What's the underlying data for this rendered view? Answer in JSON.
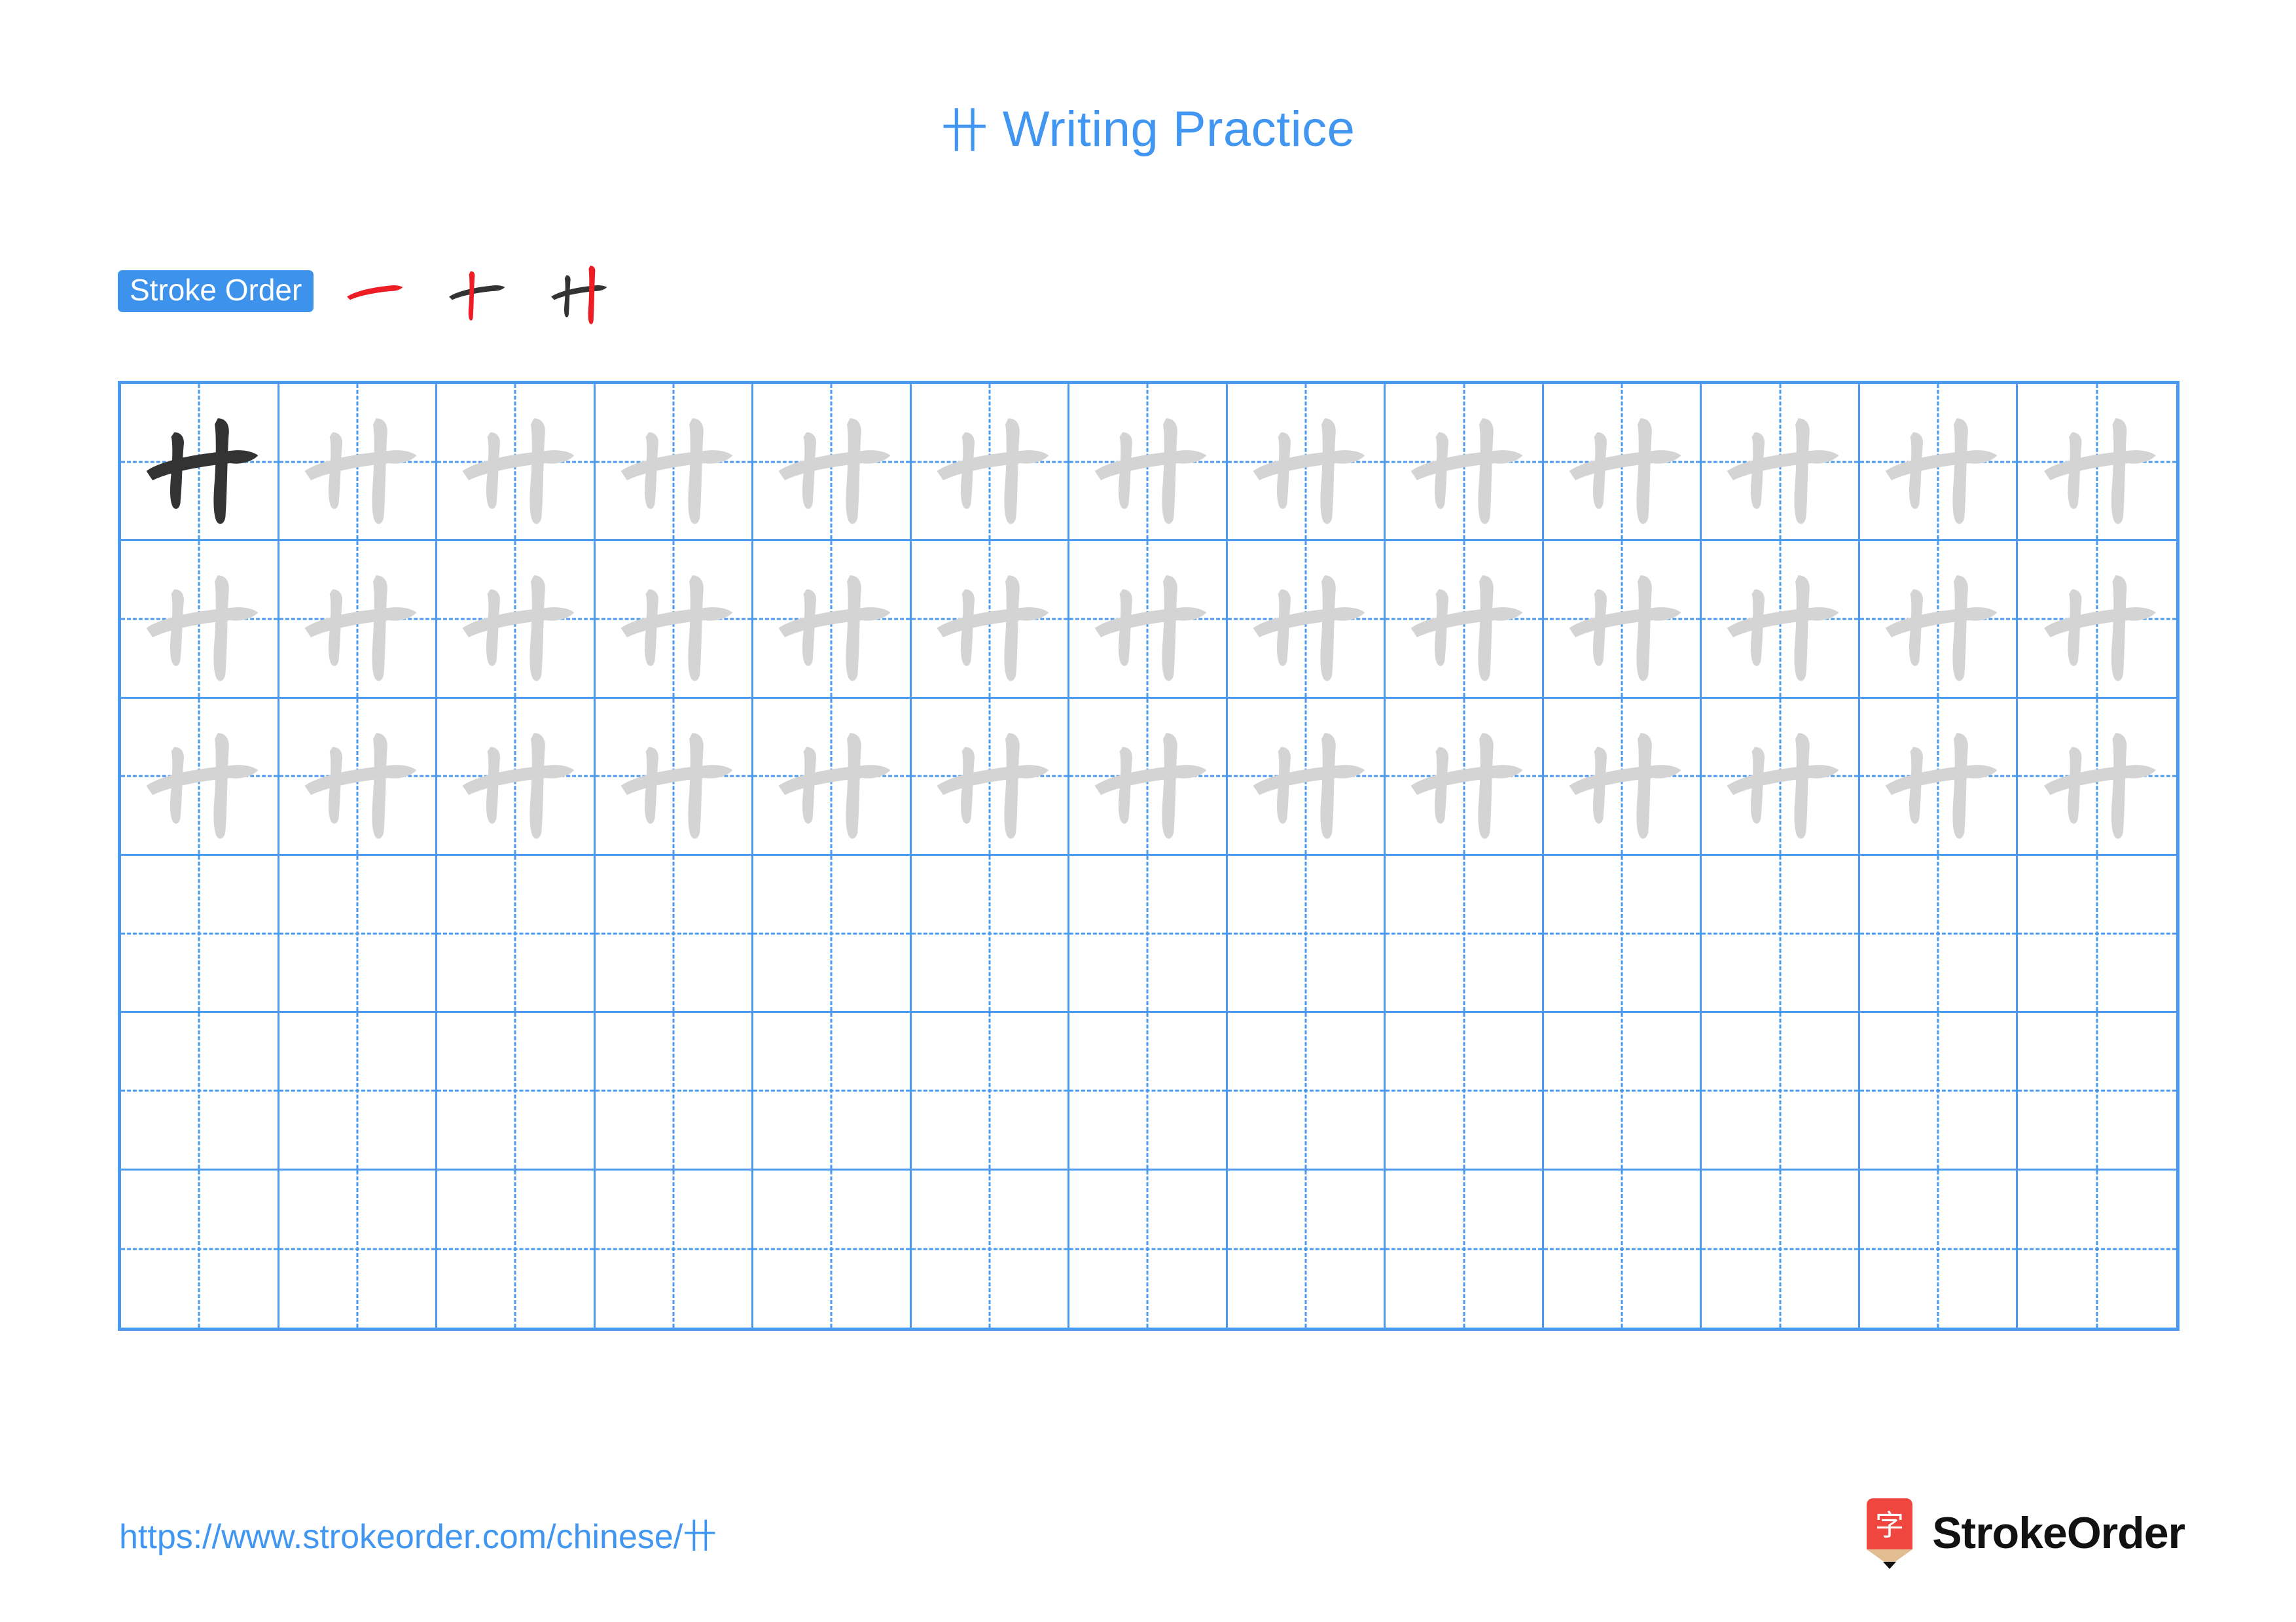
{
  "page": {
    "character": "卄",
    "title_suffix": " Writing Practice",
    "background_color": "#ffffff",
    "accent_color": "#4096f0",
    "grid_line_color": "#4a9bf0",
    "traced_stroke_color": "#d4d4d4",
    "solid_stroke_color": "#333333",
    "new_stroke_color": "#ee1c25"
  },
  "stroke_order": {
    "label": "Stroke Order",
    "badge_bg": "#3d93ec",
    "badge_text_color": "#ffffff",
    "total_strokes": 3,
    "steps": [
      {
        "index": 1,
        "strokes_shown": [
          "heng"
        ],
        "new_stroke": "heng"
      },
      {
        "index": 2,
        "strokes_shown": [
          "heng",
          "shu-left"
        ],
        "new_stroke": "shu-left"
      },
      {
        "index": 3,
        "strokes_shown": [
          "heng",
          "shu-left",
          "shu-right"
        ],
        "new_stroke": "shu-right"
      }
    ]
  },
  "grid": {
    "columns": 13,
    "rows": 6,
    "rows_data": [
      {
        "row": 1,
        "cells": [
          "solid",
          "trace",
          "trace",
          "trace",
          "trace",
          "trace",
          "trace",
          "trace",
          "trace",
          "trace",
          "trace",
          "trace",
          "trace"
        ]
      },
      {
        "row": 2,
        "cells": [
          "trace",
          "trace",
          "trace",
          "trace",
          "trace",
          "trace",
          "trace",
          "trace",
          "trace",
          "trace",
          "trace",
          "trace",
          "trace"
        ]
      },
      {
        "row": 3,
        "cells": [
          "trace",
          "trace",
          "trace",
          "trace",
          "trace",
          "trace",
          "trace",
          "trace",
          "trace",
          "trace",
          "trace",
          "trace",
          "trace"
        ]
      },
      {
        "row": 4,
        "cells": [
          "empty",
          "empty",
          "empty",
          "empty",
          "empty",
          "empty",
          "empty",
          "empty",
          "empty",
          "empty",
          "empty",
          "empty",
          "empty"
        ]
      },
      {
        "row": 5,
        "cells": [
          "empty",
          "empty",
          "empty",
          "empty",
          "empty",
          "empty",
          "empty",
          "empty",
          "empty",
          "empty",
          "empty",
          "empty",
          "empty"
        ]
      },
      {
        "row": 6,
        "cells": [
          "empty",
          "empty",
          "empty",
          "empty",
          "empty",
          "empty",
          "empty",
          "empty",
          "empty",
          "empty",
          "empty",
          "empty",
          "empty"
        ]
      }
    ]
  },
  "footer": {
    "url": "https://www.strokeorder.com/chinese/卄",
    "brand_name": "StrokeOrder",
    "brand_icon_glyph": "字",
    "brand_icon_bg": "#ef4640",
    "brand_icon_wood": "#e2bd93",
    "brand_icon_tip": "#111111"
  }
}
